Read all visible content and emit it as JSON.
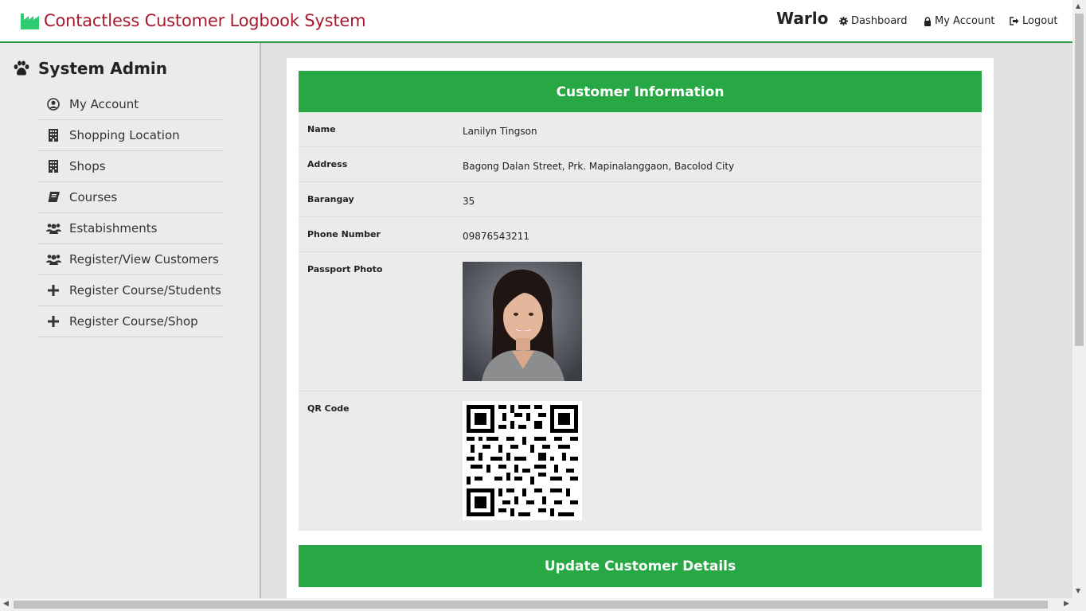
{
  "header": {
    "title": "Contactless Customer Logbook System",
    "user": "Warlo",
    "links": {
      "dashboard": "Dashboard",
      "account": "My Account",
      "logout": "Logout"
    }
  },
  "sidebar": {
    "title": "System Admin",
    "items": [
      {
        "label": "My Account",
        "icon": "user-circle-icon"
      },
      {
        "label": "Shopping Location",
        "icon": "building-icon"
      },
      {
        "label": "Shops",
        "icon": "building-icon"
      },
      {
        "label": "Courses",
        "icon": "book-icon"
      },
      {
        "label": "Estabishments",
        "icon": "users-icon"
      },
      {
        "label": "Register/View Customers",
        "icon": "users-icon"
      },
      {
        "label": "Register Course/Students",
        "icon": "plus-icon"
      },
      {
        "label": "Register Course/Shop",
        "icon": "plus-icon"
      }
    ]
  },
  "customer": {
    "heading": "Customer Information",
    "fields": {
      "name_label": "Name",
      "name": "Lanilyn Tingson",
      "address_label": "Address",
      "address": "Bagong Dalan Street, Prk. Mapinalanggaon, Bacolod City",
      "barangay_label": "Barangay",
      "barangay": "35",
      "phone_label": "Phone Number",
      "phone": "09876543211",
      "photo_label": "Passport Photo",
      "qr_label": "QR Code"
    }
  },
  "update": {
    "heading": "Update Customer Details"
  },
  "colors": {
    "accent": "#28a745",
    "brand": "#a8192e",
    "nav_border": "#2e9a45"
  }
}
